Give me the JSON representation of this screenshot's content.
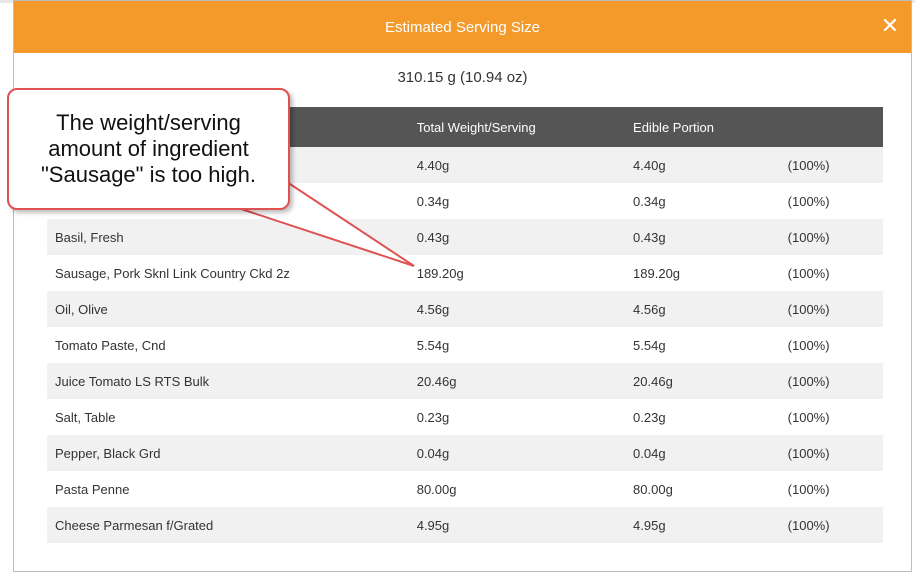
{
  "modal": {
    "title": "Estimated Serving Size",
    "close_label": "✕",
    "serving_total": "310.15 g (10.94 oz)"
  },
  "table": {
    "headers": [
      "Total Weight/Serving",
      "Edible Portion"
    ],
    "rows": [
      {
        "name": "",
        "total": "4.40g",
        "edible": "4.40g",
        "pct": "(100%)"
      },
      {
        "name": "",
        "total": "0.34g",
        "edible": "0.34g",
        "pct": "(100%)"
      },
      {
        "name": "Basil, Fresh",
        "total": "0.43g",
        "edible": "0.43g",
        "pct": "(100%)"
      },
      {
        "name": "Sausage, Pork Sknl Link Country Ckd 2z",
        "total": "189.20g",
        "edible": "189.20g",
        "pct": "(100%)"
      },
      {
        "name": "Oil, Olive",
        "total": "4.56g",
        "edible": "4.56g",
        "pct": "(100%)"
      },
      {
        "name": "Tomato Paste, Cnd",
        "total": "5.54g",
        "edible": "5.54g",
        "pct": "(100%)"
      },
      {
        "name": "Juice Tomato LS RTS Bulk",
        "total": "20.46g",
        "edible": "20.46g",
        "pct": "(100%)"
      },
      {
        "name": "Salt, Table",
        "total": "0.23g",
        "edible": "0.23g",
        "pct": "(100%)"
      },
      {
        "name": "Pepper, Black Grd",
        "total": "0.04g",
        "edible": "0.04g",
        "pct": "(100%)"
      },
      {
        "name": "Pasta Penne",
        "total": "80.00g",
        "edible": "80.00g",
        "pct": "(100%)"
      },
      {
        "name": "Cheese Parmesan f/Grated",
        "total": "4.95g",
        "edible": "4.95g",
        "pct": "(100%)"
      }
    ]
  },
  "callout": {
    "lines": [
      "The weight/serving",
      "amount of ingredient",
      "\"Sausage\" is too high."
    ]
  },
  "colors": {
    "header_orange": "#f39a2a",
    "table_header": "#555555",
    "callout_border": "#e05252"
  },
  "icons": {
    "close": "close-icon"
  }
}
